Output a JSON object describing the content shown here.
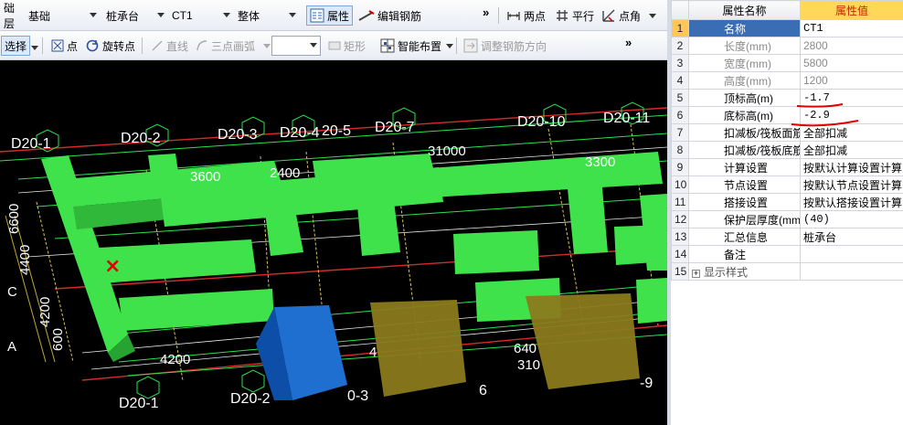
{
  "toolbar1": {
    "floor": "础层",
    "category": "基础",
    "element_type": "桩承台",
    "element_name": "CT1",
    "scope": "整体",
    "properties_button": "属性",
    "edit_rebar_button": "编辑钢筋",
    "more": "»",
    "two_point": "两点",
    "parallel": "平行",
    "point_angle": "点角"
  },
  "toolbar2": {
    "select": "选择",
    "point": "点",
    "rotate_point": "旋转点",
    "line": "直线",
    "three_point_arc": "三点画弧",
    "shape_combo": "",
    "rectangle": "矩形",
    "smart_layout": "智能布置",
    "adjust_rebar_direction": "调整钢筋方向",
    "more": "»"
  },
  "viewport": {
    "axis_labels_top": [
      "D20-1",
      "D20-2",
      "D20-3",
      "D20-4",
      "20-5",
      "D20-7",
      "D20-10",
      "D20-11"
    ],
    "axis_labels_bottom": [
      "D20-1",
      "D20-2",
      "0-3",
      "6",
      "-9"
    ],
    "dimensions": [
      "3600",
      "2400",
      "31000",
      "3300",
      "4200",
      "640",
      "310",
      "4"
    ],
    "left_dims": [
      "6600",
      "4400",
      "4200",
      "600"
    ],
    "left_letters": [
      "C",
      "A"
    ],
    "marker": "×"
  },
  "properties": {
    "header_name": "属性名称",
    "header_value": "属性值",
    "rows": [
      {
        "num": "1",
        "name": "名称",
        "value": "CT1",
        "style": "selected"
      },
      {
        "num": "2",
        "name": "长度(mm)",
        "value": "2800",
        "style": "gray"
      },
      {
        "num": "3",
        "name": "宽度(mm)",
        "value": "5800",
        "style": "gray"
      },
      {
        "num": "4",
        "name": "高度(mm)",
        "value": "1200",
        "style": "gray"
      },
      {
        "num": "5",
        "name": "顶标高(m)",
        "value": "-1.7",
        "style": "normal"
      },
      {
        "num": "6",
        "name": "底标高(m)",
        "value": "-2.9",
        "style": "normal"
      },
      {
        "num": "7",
        "name": "扣减板/筏板面筋",
        "value": "全部扣减",
        "style": "normal"
      },
      {
        "num": "8",
        "name": "扣减板/筏板底筋",
        "value": "全部扣减",
        "style": "normal"
      },
      {
        "num": "9",
        "name": "计算设置",
        "value": "按默认计算设置计算",
        "style": "normal"
      },
      {
        "num": "10",
        "name": "节点设置",
        "value": "按默认节点设置计算",
        "style": "normal"
      },
      {
        "num": "11",
        "name": "搭接设置",
        "value": "按默认搭接设置计算",
        "style": "normal"
      },
      {
        "num": "12",
        "name": "保护层厚度(mm)",
        "value": "(40)",
        "style": "normal"
      },
      {
        "num": "13",
        "name": "汇总信息",
        "value": "桩承台",
        "style": "normal"
      },
      {
        "num": "14",
        "name": "备注",
        "value": "",
        "style": "normal"
      },
      {
        "num": "15",
        "name": "显示样式",
        "value": "",
        "style": "expand"
      }
    ]
  },
  "colors": {
    "accent_green": "#3fe24a",
    "canvas_bg": "#000000",
    "selected_row": "#3b6db5",
    "header_value_bg": "#ffd85a",
    "annotation_red": "#e00000"
  }
}
